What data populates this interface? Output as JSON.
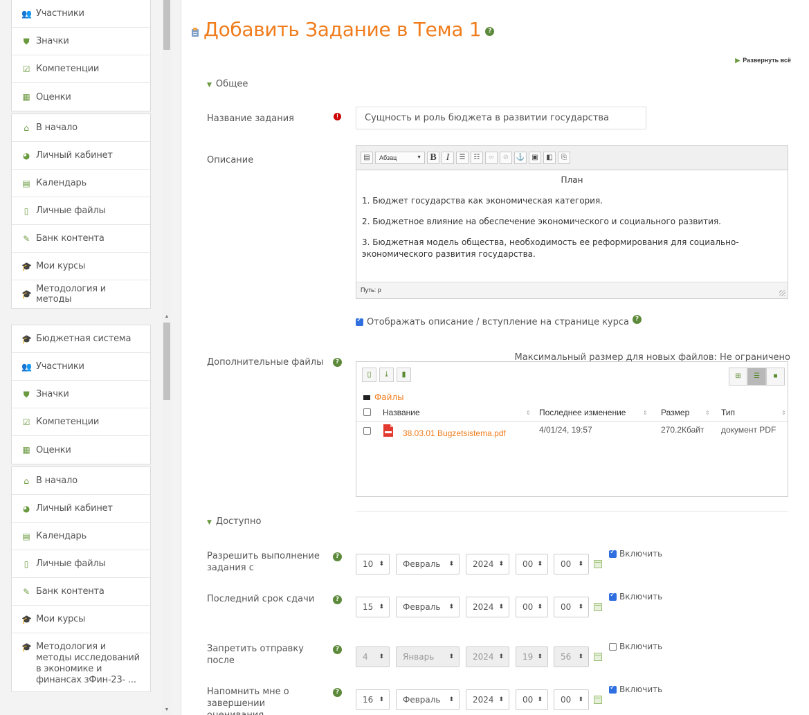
{
  "sidebar_top": {
    "groups": [
      [
        {
          "label": "Участники",
          "icon": "users-icon",
          "glyph": "👥"
        },
        {
          "label": "Значки",
          "icon": "shield-icon",
          "glyph": "⛊"
        },
        {
          "label": "Компетенции",
          "icon": "checkbox-icon",
          "glyph": "☑"
        },
        {
          "label": "Оценки",
          "icon": "table-icon",
          "glyph": "▦"
        }
      ],
      [
        {
          "label": "В начало",
          "icon": "home-icon",
          "glyph": "⌂"
        },
        {
          "label": "Личный кабинет",
          "icon": "dashboard-icon",
          "glyph": "◕"
        },
        {
          "label": "Календарь",
          "icon": "calendar-icon",
          "glyph": "▤"
        },
        {
          "label": "Личные файлы",
          "icon": "file-icon",
          "glyph": "▯"
        },
        {
          "label": "Банк контента",
          "icon": "brush-icon",
          "glyph": "✎"
        },
        {
          "label": "Мои курсы",
          "icon": "graduation-cap-icon",
          "glyph": "🎓"
        },
        {
          "label": "Методология и методы",
          "icon": "graduation-cap-icon",
          "glyph": "🎓"
        }
      ]
    ]
  },
  "sidebar_bottom": {
    "groups": [
      [
        {
          "label": "Бюджетная система",
          "icon": "graduation-cap-icon",
          "glyph": "🎓"
        },
        {
          "label": "Участники",
          "icon": "users-icon",
          "glyph": "👥"
        },
        {
          "label": "Значки",
          "icon": "shield-icon",
          "glyph": "⛊"
        },
        {
          "label": "Компетенции",
          "icon": "checkbox-icon",
          "glyph": "☑"
        },
        {
          "label": "Оценки",
          "icon": "table-icon",
          "glyph": "▦"
        }
      ],
      [
        {
          "label": "В начало",
          "icon": "home-icon",
          "glyph": "⌂"
        },
        {
          "label": "Личный кабинет",
          "icon": "dashboard-icon",
          "glyph": "◕"
        },
        {
          "label": "Календарь",
          "icon": "calendar-icon",
          "glyph": "▤"
        },
        {
          "label": "Личные файлы",
          "icon": "file-icon",
          "glyph": "▯"
        },
        {
          "label": "Банк контента",
          "icon": "brush-icon",
          "glyph": "✎"
        },
        {
          "label": "Мои курсы",
          "icon": "graduation-cap-icon",
          "glyph": "🎓"
        },
        {
          "label": "Методология и методы исследований в экономике и финансах зФин-23- ...",
          "icon": "graduation-cap-icon",
          "glyph": "🎓"
        }
      ]
    ]
  },
  "page": {
    "title": "Добавить Задание в Тема 1",
    "expand_all": "Развернуть всё"
  },
  "general": {
    "heading": "Общее",
    "name_label": "Название задания",
    "name_value": "Сущность и роль бюджета в развитии государства",
    "description_label": "Описание",
    "editor": {
      "format_select": "Абзац",
      "lines": [
        "План",
        "1. Бюджет государства как экономическая категория.",
        "2. Бюджетное влияние на обеспечение экономического и социального развития.",
        "3. Бюджетная модель общества, необходимость ее реформирования для социально-экономического развития государства."
      ],
      "path": "Путь: p"
    },
    "show_description": "Отображать описание / вступление на странице курса",
    "files_label": "Дополнительные файлы",
    "max_size": "Максимальный размер для новых файлов: Не ограничено",
    "files_folder": "Файлы",
    "files_columns": [
      "Название",
      "Последнее изменение",
      "Размер",
      "Тип"
    ],
    "files": [
      {
        "name": "38.03.01 Bugzetsistema.pdf",
        "modified": "4/01/24, 19:57",
        "size": "270.2Кбайт",
        "type": "документ PDF"
      }
    ]
  },
  "availability": {
    "heading": "Доступно",
    "rows": [
      {
        "label": "Разрешить выполнение задания с",
        "day": "10",
        "month": "Февраль",
        "year": "2024",
        "hour": "00",
        "minute": "00",
        "enable": "Включить",
        "enabled": true
      },
      {
        "label": "Последний срок сдачи",
        "day": "15",
        "month": "Февраль",
        "year": "2024",
        "hour": "00",
        "minute": "00",
        "enable": "Включить",
        "enabled": true
      },
      {
        "label": "Запретить отправку после",
        "day": "4",
        "month": "Январь",
        "year": "2024",
        "hour": "19",
        "minute": "56",
        "enable": "Включить",
        "enabled": false
      },
      {
        "label": "Напомнить мне о завершении оценивания",
        "day": "16",
        "month": "Февраль",
        "year": "2024",
        "hour": "00",
        "minute": "00",
        "enable": "Включить",
        "enabled": true
      }
    ]
  },
  "colors": {
    "accent": "#f07c1b",
    "icon_green": "#6a9a3f",
    "checkbox_blue": "#2f6fe0"
  }
}
